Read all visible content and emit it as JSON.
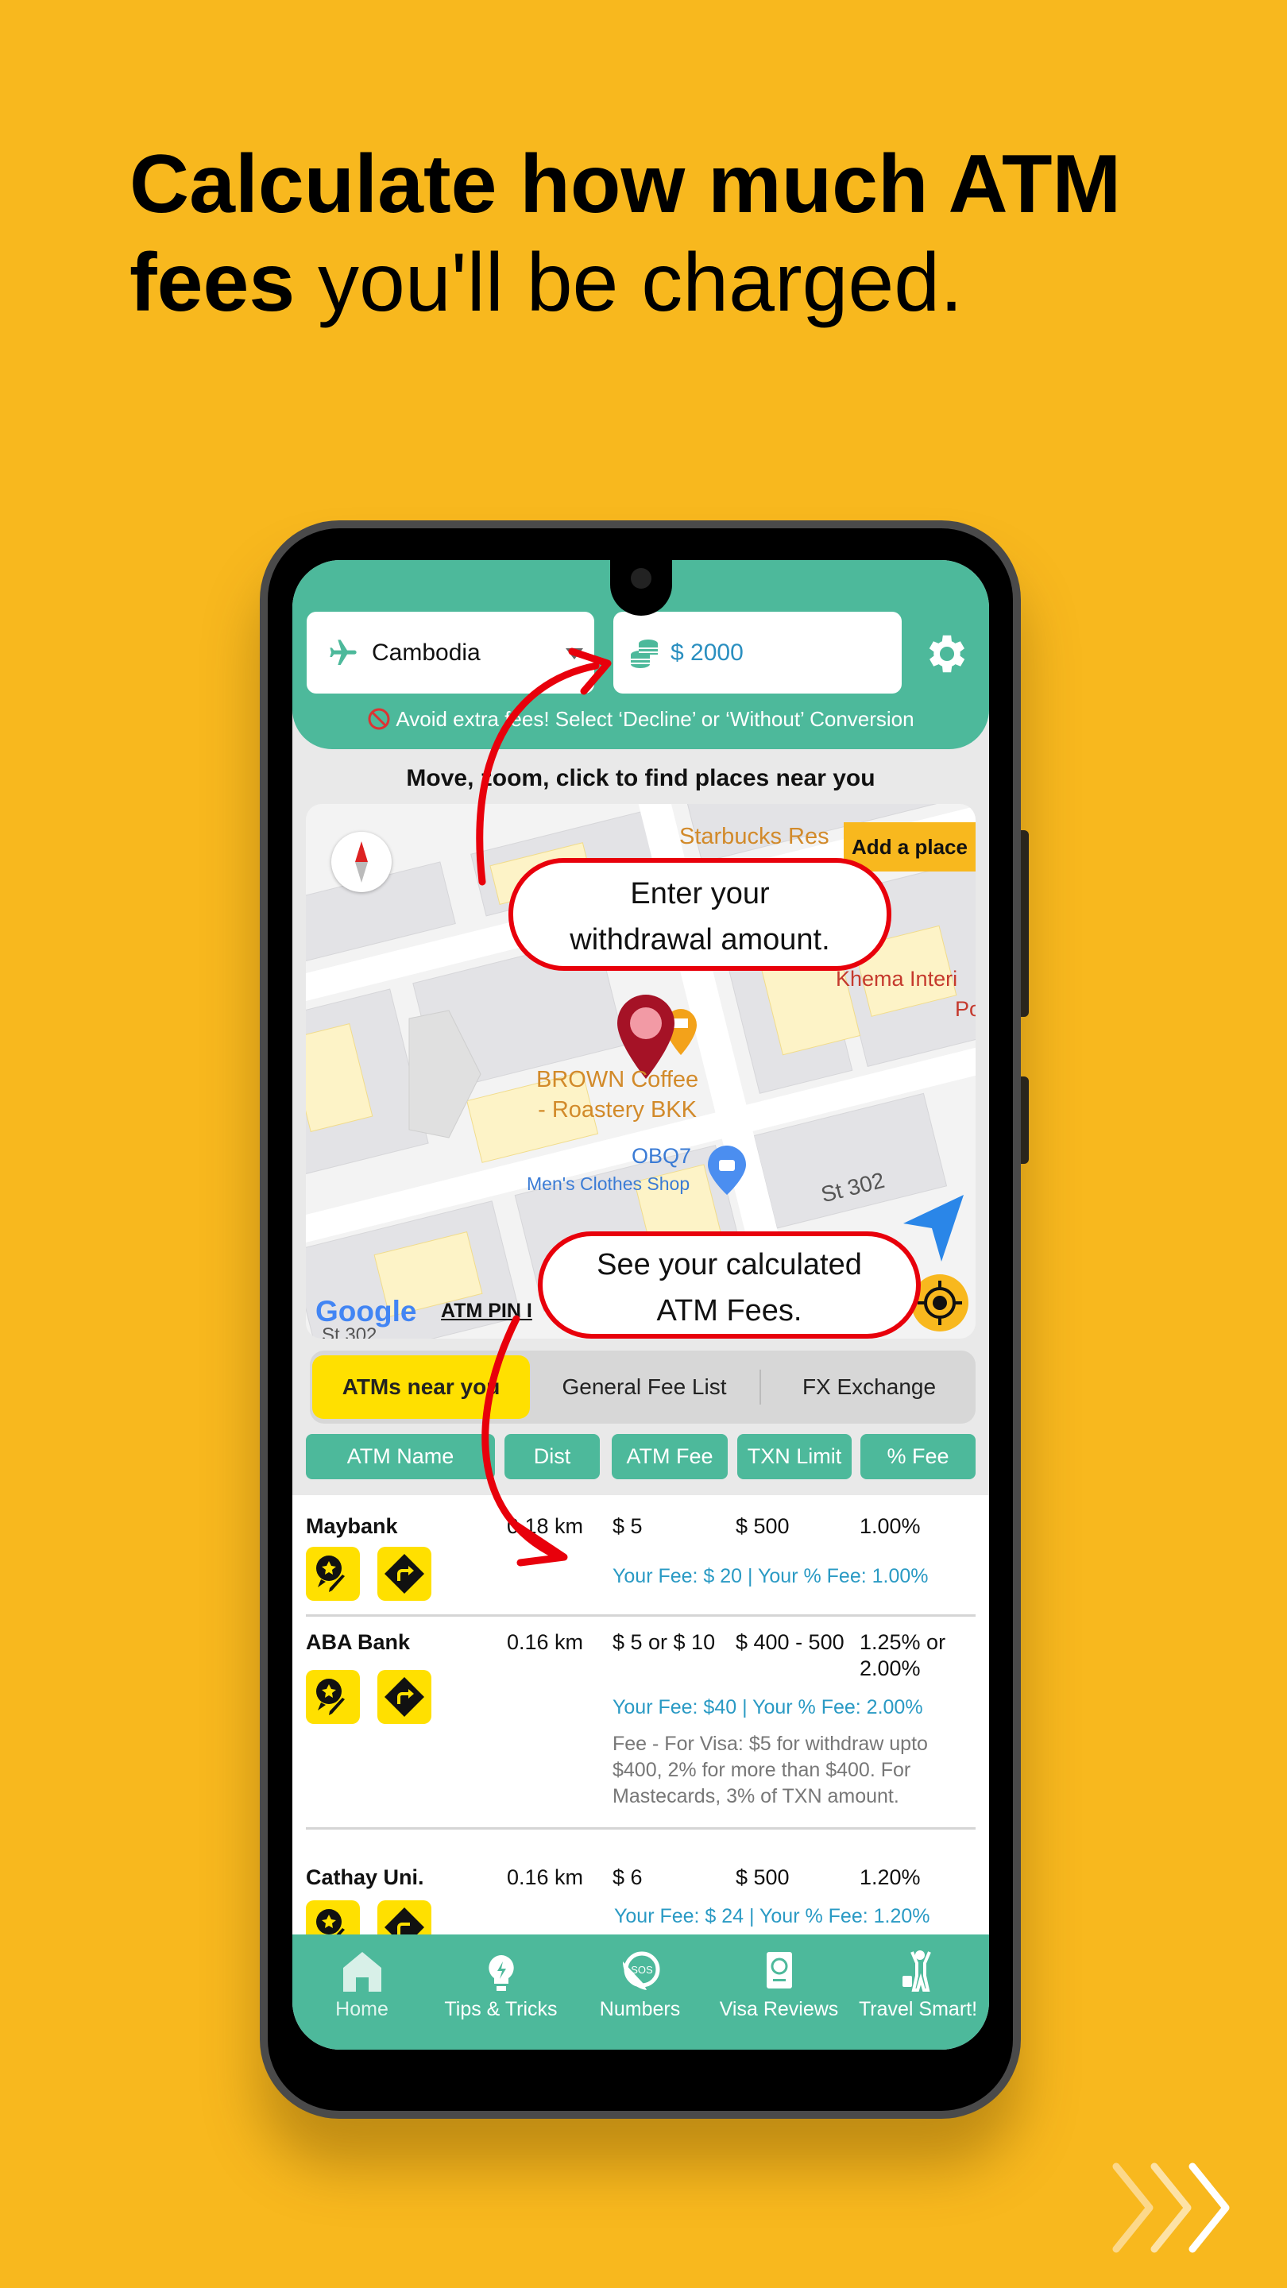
{
  "headline": {
    "bold1": "Calculate how much ATM",
    "bold2": "fees",
    "rest2": " you'll be charged."
  },
  "header": {
    "country": "Cambodia",
    "amount": "$ 2000",
    "warning": "Avoid extra fees! Select ‘Decline’ or ‘Without’ Conversion"
  },
  "map": {
    "hint": "Move, zoom, click to find places near you",
    "add_place": "Add a place",
    "labels": {
      "starbucks": "Starbucks Res",
      "khema1": "Khema Interi",
      "khema2": "Po",
      "brown1": "BROWN Coffee",
      "brown2": "- Roastery BKK",
      "obq7": "OBQ7",
      "mens": "Men's Clothes Shop",
      "street": "St 302",
      "street2": "St 302",
      "google": "Google",
      "atm_pin": "ATM PIN I"
    }
  },
  "callouts": {
    "amount": [
      "Enter your",
      "withdrawal amount."
    ],
    "fees": [
      "See your calculated",
      "ATM Fees."
    ]
  },
  "tabs": [
    {
      "label": "ATMs near you",
      "active": true
    },
    {
      "label": "General Fee List"
    },
    {
      "label": "FX Exchange"
    }
  ],
  "columns": [
    "ATM Name",
    "Dist",
    "ATM Fee",
    "TXN Limit",
    "% Fee"
  ],
  "rows": [
    {
      "name": "Maybank",
      "dist": "0.18 km",
      "fee": "$ 5",
      "limit": "$ 500",
      "pct": "1.00%",
      "your": "Your Fee: $ 20 |  Your % Fee: 1.00%"
    },
    {
      "name": "ABA Bank",
      "dist": "0.16 km",
      "fee": "$ 5 or $ 10",
      "limit": "$ 400 - 500",
      "pct": "1.25% or",
      "pct2": "2.00%",
      "your": "Your Fee: $40 |  Your % Fee: 2.00%",
      "note": "Fee - For Visa: $5 for withdraw upto $400, 2% for more than $400. For Mastecards, 3% of TXN amount."
    },
    {
      "name": "Cathay Uni.",
      "dist": "0.16 km",
      "fee": "$ 6",
      "limit": "$ 500",
      "pct": "1.20%",
      "your": "Your Fee: $ 24 |  Your % Fee: 1.20%"
    }
  ],
  "nav": [
    {
      "label": "Home",
      "icon": "home-icon",
      "active": true
    },
    {
      "label": "Tips & Tricks",
      "icon": "lightbulb-icon"
    },
    {
      "label": "Numbers",
      "icon": "sos-phone-icon"
    },
    {
      "label": "Visa Reviews",
      "icon": "passport-icon"
    },
    {
      "label": "Travel Smart!",
      "icon": "traveler-icon"
    }
  ],
  "colors": {
    "background": "#F8B81E",
    "teal": "#4DB99B",
    "accent_yellow": "#FFE000",
    "callout_red": "#E8000B",
    "fee_blue": "#2A9AC4"
  }
}
